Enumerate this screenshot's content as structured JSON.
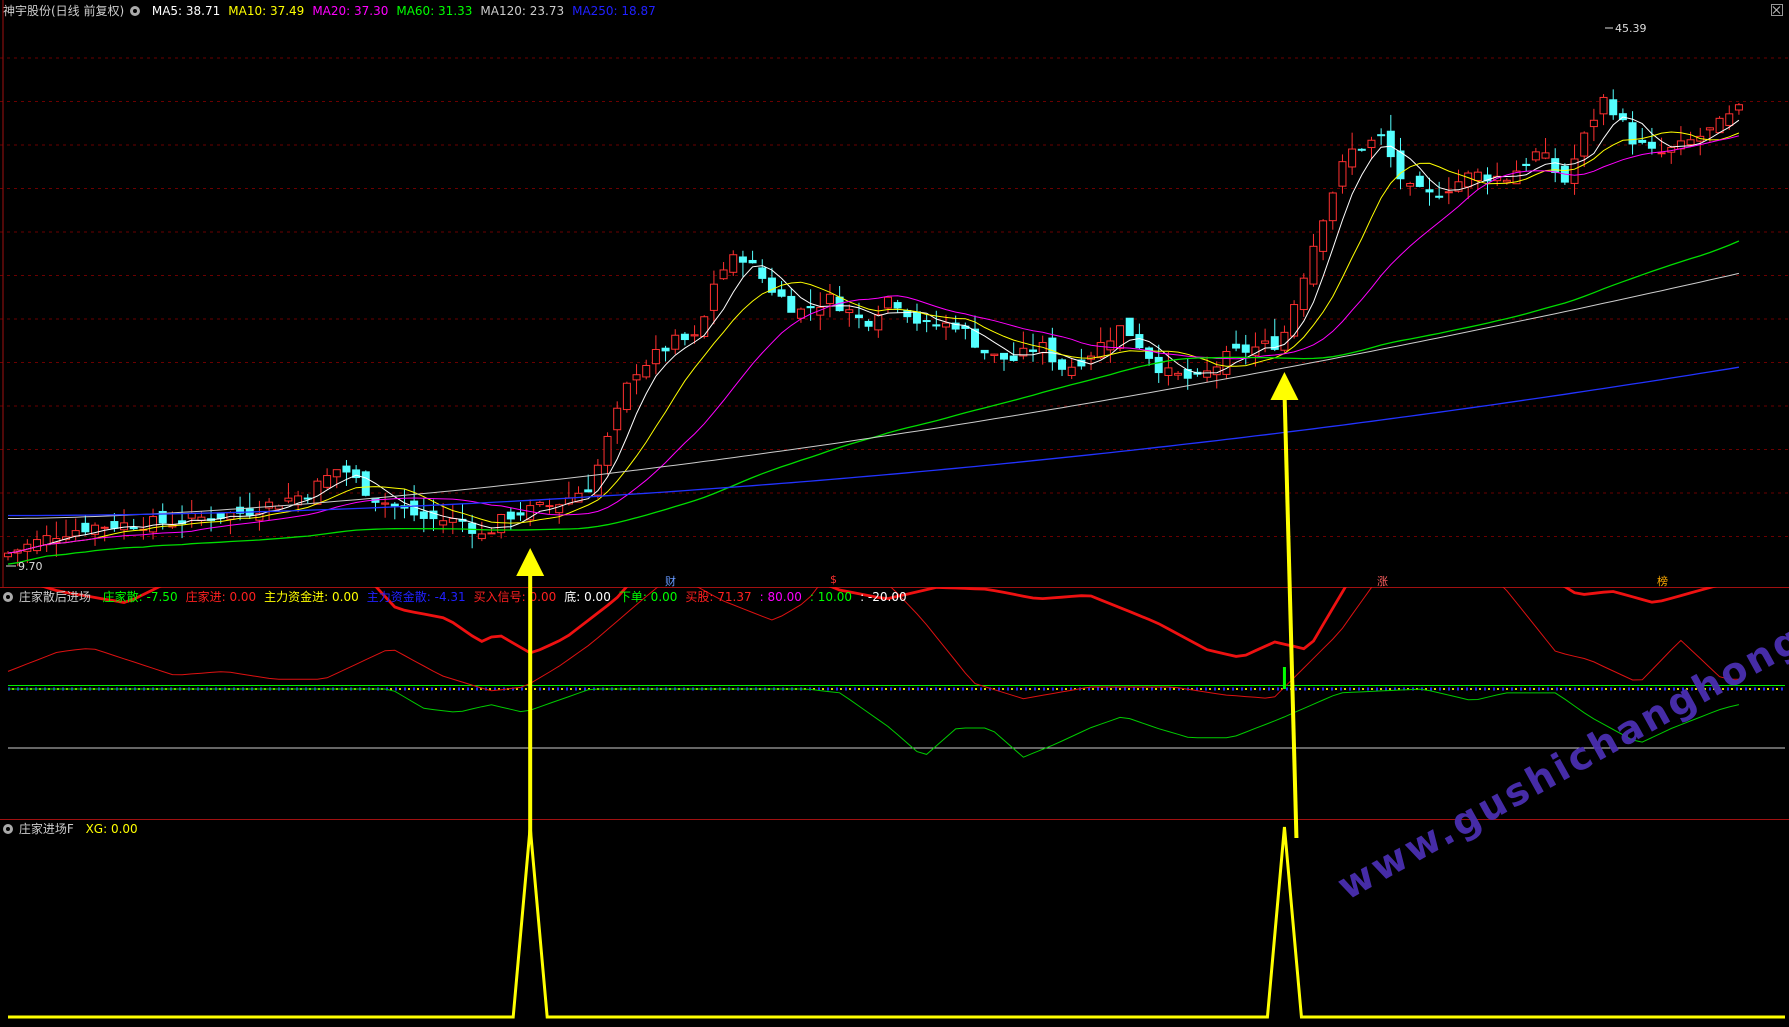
{
  "header": {
    "stock": "神宇股份(日线 前复权)",
    "ma": [
      {
        "label": "MA5: 38.71",
        "color": "#ffffff"
      },
      {
        "label": "MA10: 37.49",
        "color": "#ffff00"
      },
      {
        "label": "MA20: 37.30",
        "color": "#ff00ff"
      },
      {
        "label": "MA60: 31.33",
        "color": "#00ff00"
      },
      {
        "label": "MA120: 23.73",
        "color": "#cccccc"
      },
      {
        "label": "MA250: 18.87",
        "color": "#2020ff"
      }
    ]
  },
  "indicator1": {
    "name": "庄家散后进场",
    "items": [
      {
        "label": "庄家散: -7.50",
        "color": "#00ff00"
      },
      {
        "label": "庄家进: 0.00",
        "color": "#ff2020"
      },
      {
        "label": "主力资金进: 0.00",
        "color": "#ffff00"
      },
      {
        "label": "主力资金散: -4.31",
        "color": "#2020ff"
      },
      {
        "label": "买入信号: 0.00",
        "color": "#ff2020"
      },
      {
        "label": "底: 0.00",
        "color": "#ffffff"
      },
      {
        "label": "下单: 0.00",
        "color": "#00ff00"
      },
      {
        "label": "买股: 71.37",
        "color": "#ff2020"
      },
      {
        "label": ": 80.00",
        "color": "#ff00ff"
      },
      {
        "label": ": 10.00",
        "color": "#00ff00"
      },
      {
        "label": ": -20.00",
        "color": "#ffffff"
      }
    ]
  },
  "indicator2": {
    "name": "庄家进场F",
    "items": [
      {
        "label": "XG: 0.00",
        "color": "#ffff00"
      }
    ]
  },
  "price_labels": {
    "high": "45.39",
    "low": "9.70"
  },
  "markers": [
    {
      "text": "财",
      "color": "#6699ff"
    },
    {
      "text": "$",
      "color": "#ff3030"
    },
    {
      "text": "涨",
      "color": "#ff6060"
    },
    {
      "text": "榜",
      "color": "#ffaa00"
    }
  ],
  "watermark": "www.gushichanghong.com",
  "chart_data": {
    "type": "candlestick",
    "title": "神宇股份(日线 前复权)",
    "price_range": [
      9.7,
      45.39
    ],
    "xg_signal_positions": [
      63,
      153
    ],
    "xg_signal_value": 1
  }
}
